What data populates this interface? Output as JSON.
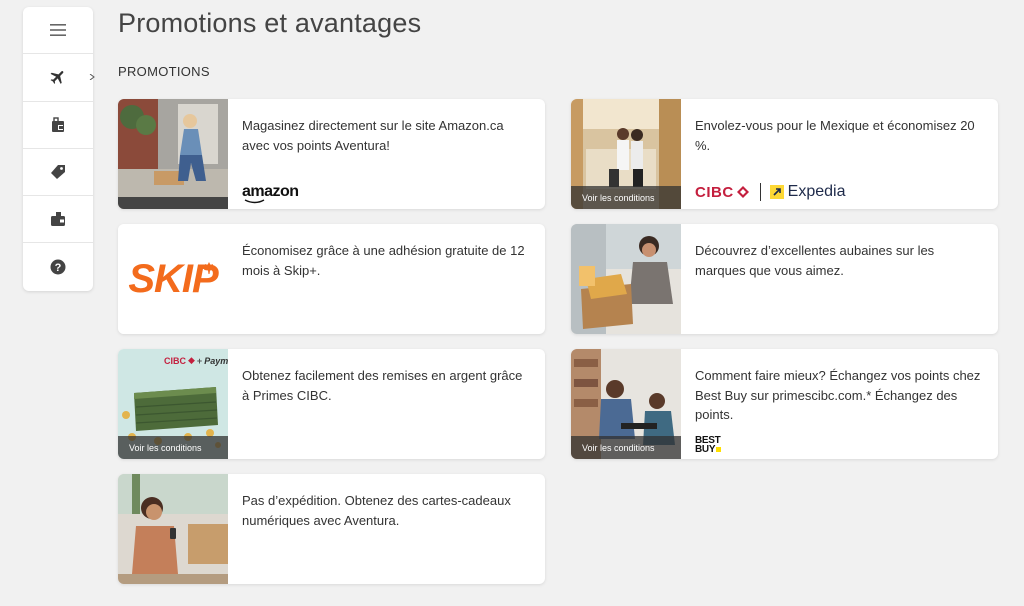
{
  "page": {
    "title": "Promotions et avantages",
    "section_label": "PROMOTIONS"
  },
  "sidebar": {
    "items": [
      {
        "icon": "menu-icon"
      },
      {
        "icon": "plane-icon"
      },
      {
        "icon": "shopping-bag-icon"
      },
      {
        "icon": "tag-icon"
      },
      {
        "icon": "wallet-icon"
      },
      {
        "icon": "help-icon"
      }
    ]
  },
  "cards": [
    {
      "text": "Magasinez directement sur le site Amazon.ca avec vos points Aventura!",
      "brand": "amazon"
    },
    {
      "text": "Envolez-vous pour le Mexique et économisez 20 %.",
      "conditions": "Voir les conditions",
      "brand_left": "CIBC",
      "brand_right": "Expedia"
    },
    {
      "text": "Économisez grâce à une adhésion gratuite de 12 mois à Skip+.",
      "brand": "SKIP"
    },
    {
      "text": "Découvrez d’excellentes aubaines sur les marques que vous aimez."
    },
    {
      "text": "Obtenez facilement des remises en argent grâce à Primes CIBC.",
      "conditions": "Voir les conditions",
      "image_brand_left": "CIBC",
      "image_brand_right": "Paymi"
    },
    {
      "text": "Comment faire mieux? Échangez vos points chez Best Buy sur primescibc.com.* Échangez des points.",
      "conditions": "Voir les conditions",
      "brand_line1": "BEST",
      "brand_line2": "BUY"
    },
    {
      "text": "Pas d’expédition. Obtenez des cartes-cadeaux numériques avec Aventura."
    }
  ],
  "colors": {
    "background": "#f1f1f1",
    "cibc_red": "#c41f3e",
    "skip_orange": "#f36b1c",
    "expedia_yellow": "#fdd835",
    "bestbuy_yellow": "#ffe000"
  }
}
